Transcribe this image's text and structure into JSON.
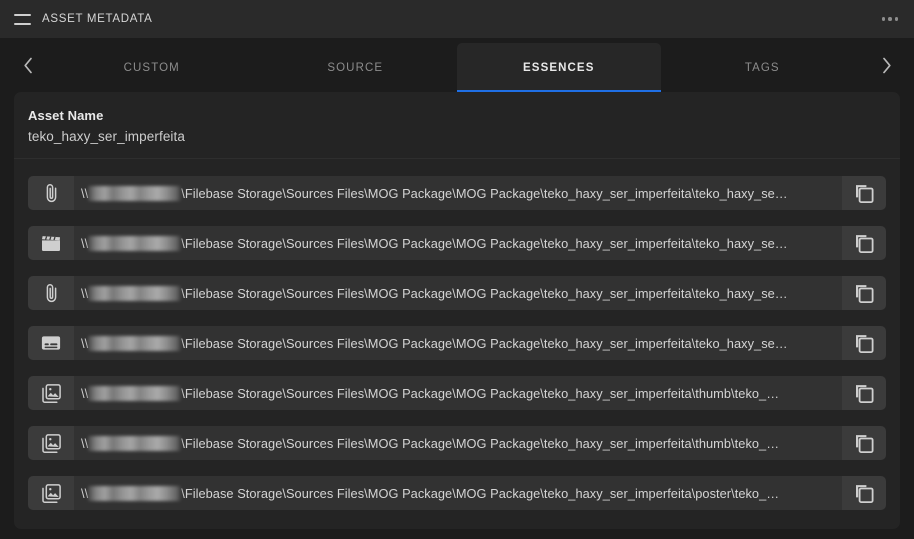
{
  "theme": {
    "accent": "#1f6fe5",
    "background": "#1c1c1c",
    "panel_background": "#242424",
    "topbar_background": "#2a2a2a",
    "field_background": "#323232",
    "icon_chip_background": "#3b3b3b",
    "text_primary": "#e9e9e9",
    "text_secondary": "#8c8c8c"
  },
  "topbar": {
    "menu_icon": "hamburger-icon",
    "title": "ASSET METADATA",
    "overflow_icon": "more-horizontal-icon"
  },
  "tabbar": {
    "prev_icon": "chevron-left-icon",
    "next_icon": "chevron-right-icon",
    "tabs": [
      {
        "label": "CUSTOM",
        "active": false
      },
      {
        "label": "SOURCE",
        "active": false
      },
      {
        "label": "ESSENCES",
        "active": true
      },
      {
        "label": "TAGS",
        "active": false
      }
    ]
  },
  "panel": {
    "asset": {
      "label": "Asset Name",
      "value": "teko_haxy_ser_imperfeita"
    },
    "copy_icon": "copy-icon",
    "path_prefix": "\\\\",
    "rows": [
      {
        "icon": "paperclip-icon",
        "path_suffix": "\\Filebase Storage\\Sources Files\\MOG Package\\MOG Package\\teko_haxy_ser_imperfeita\\teko_haxy_se…",
        "copy_label": "Copy path"
      },
      {
        "icon": "clapperboard-icon",
        "path_suffix": "\\Filebase Storage\\Sources Files\\MOG Package\\MOG Package\\teko_haxy_ser_imperfeita\\teko_haxy_se…",
        "copy_label": "Copy path"
      },
      {
        "icon": "paperclip-icon",
        "path_suffix": "\\Filebase Storage\\Sources Files\\MOG Package\\MOG Package\\teko_haxy_ser_imperfeita\\teko_haxy_se…",
        "copy_label": "Copy path"
      },
      {
        "icon": "subtitles-icon",
        "path_suffix": "\\Filebase Storage\\Sources Files\\MOG Package\\MOG Package\\teko_haxy_ser_imperfeita\\teko_haxy_se…",
        "copy_label": "Copy path"
      },
      {
        "icon": "image-collection-icon",
        "path_suffix": "\\Filebase Storage\\Sources Files\\MOG Package\\MOG Package\\teko_haxy_ser_imperfeita\\thumb\\teko_…",
        "copy_label": "Copy path"
      },
      {
        "icon": "image-collection-icon",
        "path_suffix": "\\Filebase Storage\\Sources Files\\MOG Package\\MOG Package\\teko_haxy_ser_imperfeita\\thumb\\teko_…",
        "copy_label": "Copy path"
      },
      {
        "icon": "image-collection-icon",
        "path_suffix": "\\Filebase Storage\\Sources Files\\MOG Package\\MOG Package\\teko_haxy_ser_imperfeita\\poster\\teko_…",
        "copy_label": "Copy path"
      }
    ]
  }
}
